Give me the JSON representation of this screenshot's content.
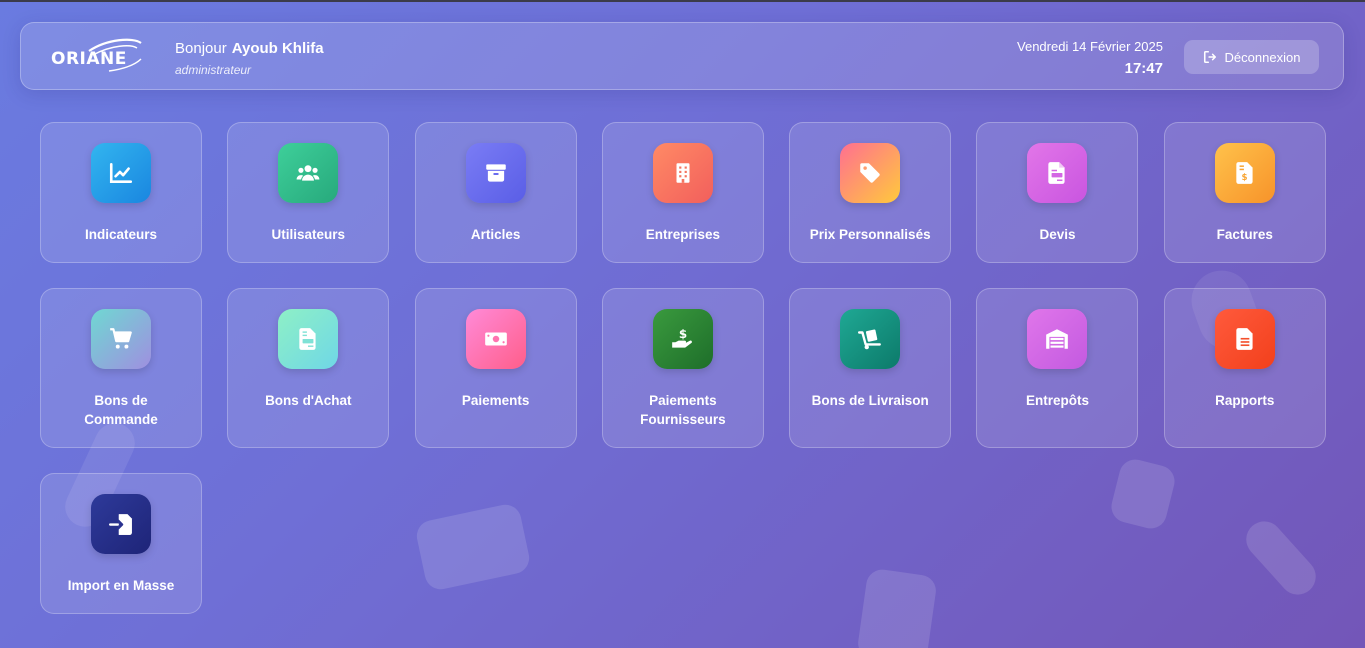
{
  "header": {
    "logo_text": "ORIANE",
    "greeting": "Bonjour",
    "user_name": "Ayoub Khlifa",
    "role": "administrateur",
    "date": "Vendredi 14 Février 2025",
    "time": "17:47",
    "logout_label": "Déconnexion"
  },
  "modules": [
    {
      "label": "Indicateurs",
      "icon": "chart-line-icon",
      "color_from": "#32b5ef",
      "color_to": "#1a86e0"
    },
    {
      "label": "Utilisateurs",
      "icon": "users-icon",
      "color_from": "#3ecf9a",
      "color_to": "#27a97c"
    },
    {
      "label": "Articles",
      "icon": "box-icon",
      "color_from": "#7a7cf5",
      "color_to": "#5a5ee6"
    },
    {
      "label": "Entreprises",
      "icon": "building-icon",
      "color_from": "#ff8a65",
      "color_to": "#f25f5c"
    },
    {
      "label": "Prix Personnalisés",
      "icon": "tag-icon",
      "color_from": "#ff6f91",
      "color_to": "#ffc93c"
    },
    {
      "label": "Devis",
      "icon": "document-icon",
      "color_from": "#e276e8",
      "color_to": "#c955e0"
    },
    {
      "label": "Factures",
      "icon": "invoice-icon",
      "color_from": "#ffc24b",
      "color_to": "#f7932a"
    },
    {
      "label": "Bons de Commande",
      "icon": "cart-icon",
      "color_from": "#6fd8d2",
      "color_to": "#9f8fe0"
    },
    {
      "label": "Bons d'Achat",
      "icon": "receipt-icon",
      "color_from": "#8ef0c6",
      "color_to": "#6fd7e6"
    },
    {
      "label": "Paiements",
      "icon": "money-icon",
      "color_from": "#ff8ad8",
      "color_to": "#ff5e8a"
    },
    {
      "label": "Paiements Fournisseurs",
      "icon": "hand-dollar-icon",
      "color_from": "#3a9a3e",
      "color_to": "#1e6e2a"
    },
    {
      "label": "Bons de Livraison",
      "icon": "dolly-icon",
      "color_from": "#1fa894",
      "color_to": "#0c7a6a"
    },
    {
      "label": "Entrepôts",
      "icon": "warehouse-icon",
      "color_from": "#e076ea",
      "color_to": "#c35ae0"
    },
    {
      "label": "Rapports",
      "icon": "report-icon",
      "color_from": "#ff5a3c",
      "color_to": "#f2401c"
    },
    {
      "label": "Import en Masse",
      "icon": "import-icon",
      "color_from": "#2e3a9a",
      "color_to": "#1e2478"
    }
  ]
}
